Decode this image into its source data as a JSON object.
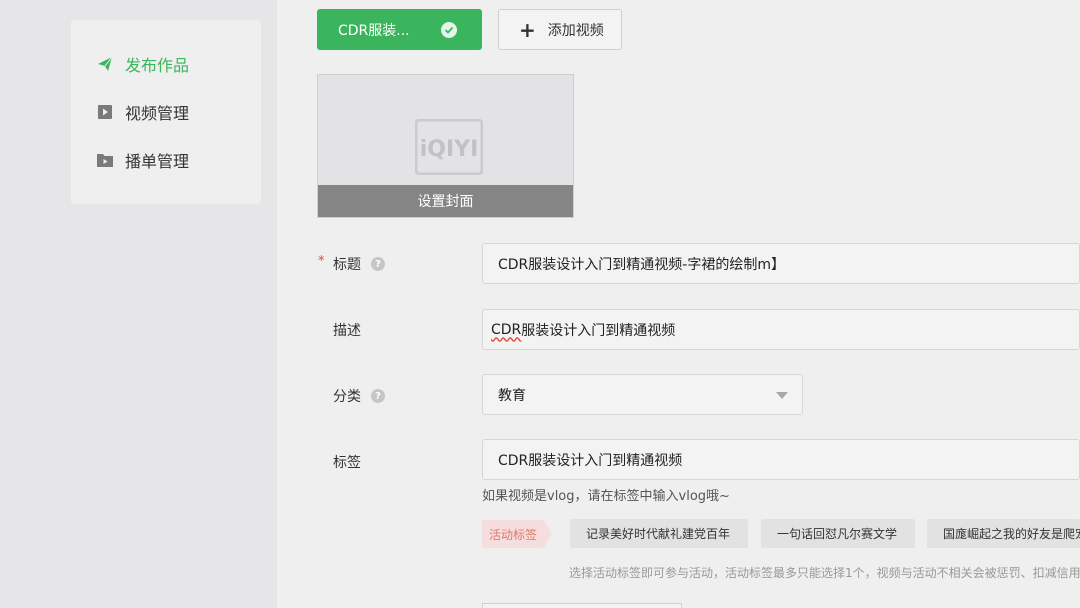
{
  "sidebar": {
    "items": [
      {
        "label": "发布作品",
        "icon": "paper-plane-icon",
        "active": true
      },
      {
        "label": "视频管理",
        "icon": "video-play-icon",
        "active": false
      },
      {
        "label": "播单管理",
        "icon": "folder-play-icon",
        "active": false
      }
    ]
  },
  "tabs": {
    "active_label": "CDR服装...",
    "add_label": "添加视频"
  },
  "cover": {
    "logo_text": "iQIYI",
    "set_cover_label": "设置封面"
  },
  "form": {
    "required_mark": "*",
    "title_label": "标题",
    "title_value": "CDR服装设计入门到精通视频-字裙的绘制m】",
    "desc_label": "描述",
    "desc_value": "CDR服装设计入门到精通视频",
    "desc_underlined": "CDR",
    "desc_rest": "服装设计入门到精通视频",
    "category_label": "分类",
    "category_value": "教育",
    "tags_label": "标签",
    "tags_value": "CDR服装设计入门到精通视频",
    "tags_hint": "如果视频是vlog，请在标签中输入vlog哦~",
    "help_glyph": "?"
  },
  "activity": {
    "label": "活动标签",
    "chips": [
      "记录美好时代献礼建党百年",
      "一句话回怼凡尔赛文学",
      "国庬崛起之我的好友是爬宠"
    ],
    "note": "选择活动标签即可参与活动，活动标签最多只能选择1个，视频与活动不相关会被惩罚、扣减信用"
  },
  "colors": {
    "accent": "#3ab55d",
    "required": "#e0493e"
  }
}
